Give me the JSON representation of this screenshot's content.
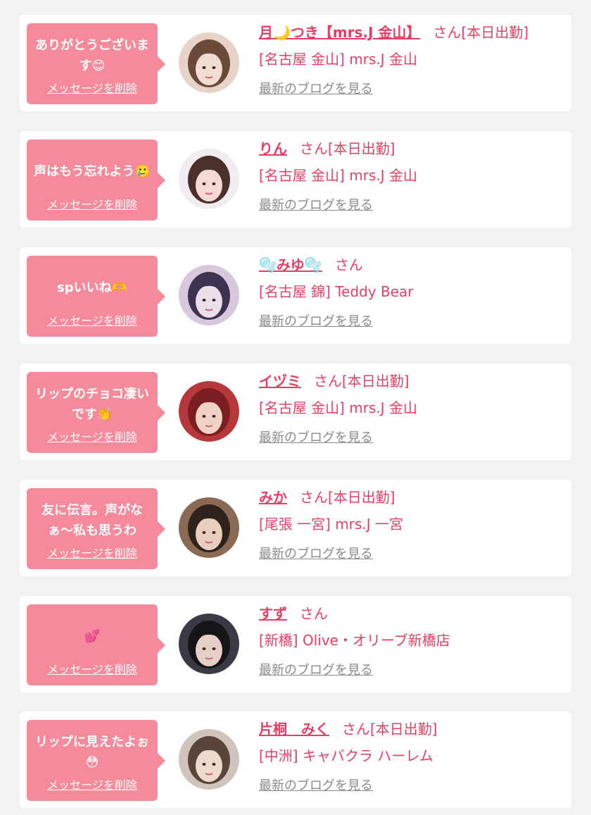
{
  "cards": [
    {
      "message": "ありがとうございます😊",
      "delete_label": "メッセージを削除",
      "name": "月🌙つき【mrs.J 金山】",
      "suffix": "さん[本日出勤]",
      "shop": "[名古屋 金山] mrs.J 金山",
      "blog_label": "最新のブログを見る",
      "avatar_icon": "avatar-photo",
      "avatar_colors": [
        "#e8d3c8",
        "#6b4a3a",
        "#f3dcd0"
      ]
    },
    {
      "message": "声はもう忘れよう🥲",
      "delete_label": "メッセージを削除",
      "name": "りん",
      "suffix": "さん[本日出勤]",
      "shop": "[名古屋 金山] mrs.J 金山",
      "blog_label": "最新のブログを見る",
      "avatar_icon": "avatar-photo",
      "avatar_colors": [
        "#f1ecef",
        "#4a2f2a",
        "#f5d9d6"
      ]
    },
    {
      "message": "spいいね🫶",
      "delete_label": "メッセージを削除",
      "name": "🫧みゆ🫧",
      "suffix": "さん",
      "shop": "[名古屋 錦] Teddy Bear",
      "blog_label": "最新のブログを見る",
      "avatar_icon": "avatar-photo",
      "avatar_colors": [
        "#d8c8de",
        "#3d3350",
        "#eae0ea"
      ]
    },
    {
      "message": "リップのチョコ凄いです👏",
      "delete_label": "メッセージを削除",
      "name": "イヅミ",
      "suffix": "さん[本日出勤]",
      "shop": "[名古屋 金山] mrs.J 金山",
      "blog_label": "最新のブログを見る",
      "avatar_icon": "avatar-photo",
      "avatar_colors": [
        "#b7383b",
        "#7a1e22",
        "#f3d2c6"
      ]
    },
    {
      "message": "友に伝言。声がなぁ〜私も思うわ",
      "delete_label": "メッセージを削除",
      "name": "みか",
      "suffix": "さん[本日出勤]",
      "shop": "[尾張 一宮] mrs.J 一宮",
      "blog_label": "最新のブログを見る",
      "avatar_icon": "avatar-photo",
      "avatar_colors": [
        "#8a6a55",
        "#2e221c",
        "#e9cdbd"
      ]
    },
    {
      "message": "💕",
      "delete_label": "メッセージを削除",
      "name": "すず",
      "suffix": "さん",
      "shop": "[新橋] Olive・オリーブ新橋店",
      "blog_label": "最新のブログを見る",
      "avatar_icon": "avatar-photo",
      "avatar_colors": [
        "#3a3a44",
        "#151518",
        "#e6cfc6"
      ]
    },
    {
      "message": "リップに見えたよぉ😳",
      "delete_label": "メッセージを削除",
      "name": "片桐　みく",
      "suffix": "さん[本日出勤]",
      "shop": "[中洲] キャバクラ ハーレム",
      "blog_label": "最新のブログを見る",
      "avatar_icon": "avatar-photo",
      "avatar_colors": [
        "#cfc3bb",
        "#5a4338",
        "#efd8cc"
      ]
    }
  ]
}
